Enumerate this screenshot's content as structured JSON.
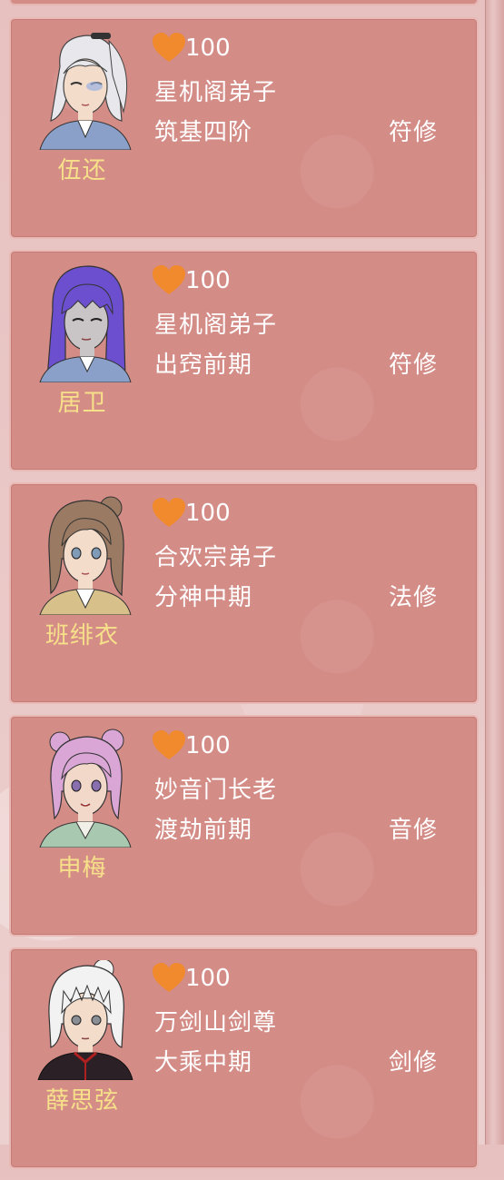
{
  "heart_color": "#f08a2c",
  "name_color": "#f7e08a",
  "card_color": "#d48c87",
  "disciples": [
    {
      "name": "伍还",
      "affinity": "100",
      "sect": "星机阁弟子",
      "realm": "筑基四阶",
      "path": "符修",
      "hair": "#e8e8ec",
      "outfit": "#8aa0c8"
    },
    {
      "name": "居卫",
      "affinity": "100",
      "sect": "星机阁弟子",
      "realm": "出窍前期",
      "path": "符修",
      "hair": "#6b4fcf",
      "outfit": "#8aa0c8"
    },
    {
      "name": "班绯衣",
      "affinity": "100",
      "sect": "合欢宗弟子",
      "realm": "分神中期",
      "path": "法修",
      "hair": "#9a7a62",
      "outfit": "#d8c08a"
    },
    {
      "name": "申梅",
      "affinity": "100",
      "sect": "妙音门长老",
      "realm": "渡劫前期",
      "path": "音修",
      "hair": "#d9a6d6",
      "outfit": "#a8c8b0"
    },
    {
      "name": "薛思弦",
      "affinity": "100",
      "sect": "万剑山剑尊",
      "realm": "大乘中期",
      "path": "剑修",
      "hair": "#f2f2f2",
      "outfit": "#2a2026"
    }
  ]
}
